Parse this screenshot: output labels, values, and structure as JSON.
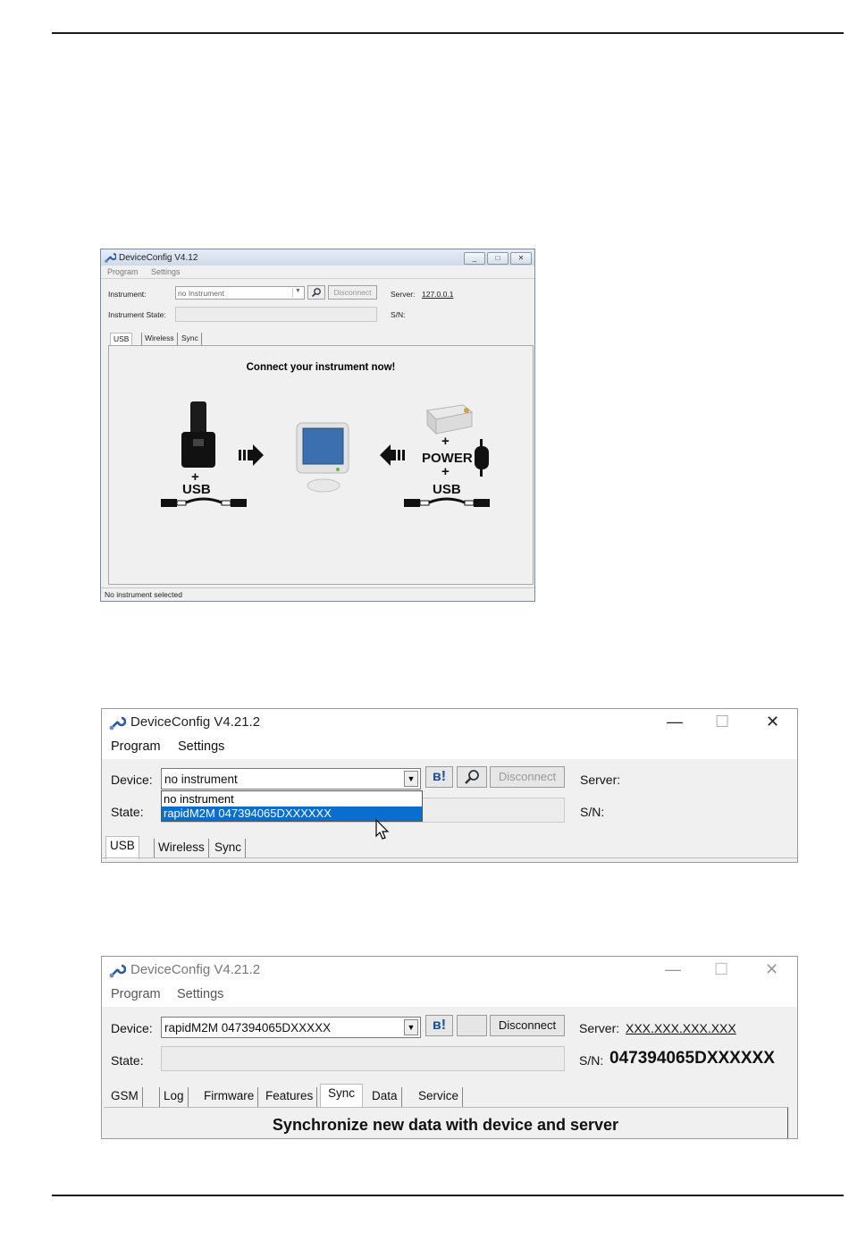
{
  "screenshot1": {
    "title": "DeviceConfig V4.12",
    "window_controls": [
      "_",
      "□",
      "✕"
    ],
    "menu": [
      "Program",
      "Settings"
    ],
    "instrument_label": "Instrument:",
    "instrument_value": "no Instrument",
    "search_icon": "magnifier-icon",
    "disconnect_label": "Disconnect",
    "server_label": "Server:",
    "server_value": "127.0.0.1",
    "state_label": "Instrument State:",
    "sn_label": "S/N:",
    "tabs": [
      "USB",
      "Wireless",
      "Sync"
    ],
    "headline": "Connect your instrument now!",
    "plus": "+",
    "usb": "USB",
    "power": "POWER",
    "status": "No instrument selected"
  },
  "screenshot2": {
    "title": "DeviceConfig V4.21.2",
    "window_controls": [
      "—",
      "☐",
      "✕"
    ],
    "menu": [
      "Program",
      "Settings"
    ],
    "device_label": "Device:",
    "device_value": "no instrument",
    "bt_label": "ʙ!",
    "disconnect_label": "Disconnect",
    "server_label": "Server:",
    "state_label": "State:",
    "sn_label": "S/N:",
    "dropdown_options": [
      "no instrument",
      "rapidM2M 047394065DXXXXXX"
    ],
    "tabs": [
      "USB",
      "Wireless",
      "Sync"
    ]
  },
  "screenshot3": {
    "title": "DeviceConfig V4.21.2",
    "window_controls": [
      "—",
      "☐",
      "✕"
    ],
    "menu": [
      "Program",
      "Settings"
    ],
    "device_label": "Device:",
    "device_value": "rapidM2M 047394065DXXXXX",
    "bt_label": "ʙ!",
    "disconnect_label": "Disconnect",
    "server_label": "Server:",
    "server_value": "XXX.XXX.XXX.XXX",
    "state_label": "State:",
    "sn_label": "S/N:",
    "sn_value": "047394065DXXXXXX",
    "tabs": [
      "GSM",
      "Log",
      "Firmware",
      "Features",
      "Sync",
      "Data",
      "Service"
    ],
    "headline": "Synchronize new data with device and server"
  }
}
